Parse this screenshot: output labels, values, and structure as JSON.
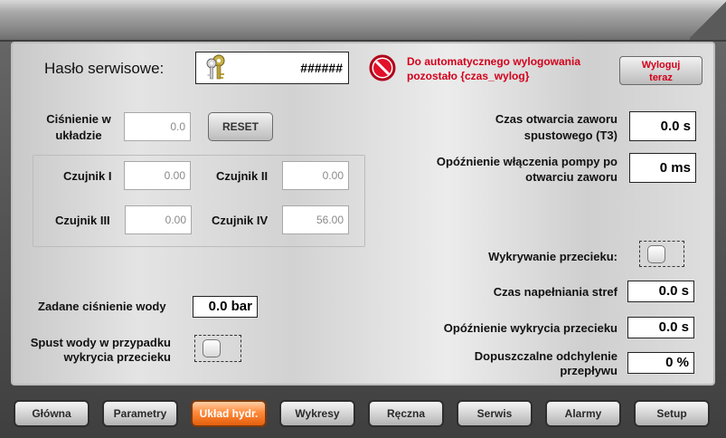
{
  "service": {
    "password_label": "Hasło serwisowe:",
    "password_value": "######",
    "logout_message_line1": "Do automatycznego wylogowania",
    "logout_message_line2": "pozostało {czas_wylog}",
    "logout_button_line1": "Wyloguj",
    "logout_button_line2": "teraz"
  },
  "pressure": {
    "label_line1": "Ciśnienie w",
    "label_line2": "układzie",
    "value": "0.0",
    "reset_label": "RESET"
  },
  "sensors": [
    {
      "label": "Czujnik I",
      "value": "0.00"
    },
    {
      "label": "Czujnik II",
      "value": "0.00"
    },
    {
      "label": "Czujnik III",
      "value": "0.00"
    },
    {
      "label": "Czujnik IV",
      "value": "56.00"
    }
  ],
  "water": {
    "set_pressure_label": "Zadane ciśnienie wody",
    "set_pressure_value": "0.0 bar",
    "drain_label_line1": "Spust wody w przypadku",
    "drain_label_line2": "wykrycia przecieku"
  },
  "right": {
    "valve_open_label_line1": "Czas otwarcia zaworu",
    "valve_open_label_line2": "spustowego (T3)",
    "valve_open_value": "0.0 s",
    "pump_delay_label_line1": "Opóźnienie włączenia pompy po",
    "pump_delay_label_line2": "otwarciu zaworu",
    "pump_delay_value": "0 ms",
    "leak_detect_label": "Wykrywanie przecieku:",
    "zone_fill_label": "Czas napełniania stref",
    "zone_fill_value": "0.0 s",
    "leak_delay_label": "Opóźnienie wykrycia przecieku",
    "leak_delay_value": "0.0 s",
    "flow_dev_label_line1": "Dopuszczalne odchylenie",
    "flow_dev_label_line2": "przepływu",
    "flow_dev_value": "0 %"
  },
  "nav": [
    {
      "label": "Główna"
    },
    {
      "label": "Parametry"
    },
    {
      "label": "Układ hydr."
    },
    {
      "label": "Wykresy"
    },
    {
      "label": "Ręczna"
    },
    {
      "label": "Serwis"
    },
    {
      "label": "Alarmy"
    },
    {
      "label": "Setup"
    }
  ],
  "colors": {
    "warning_text": "#d4001a",
    "active_tab": "#ff8a3c"
  }
}
